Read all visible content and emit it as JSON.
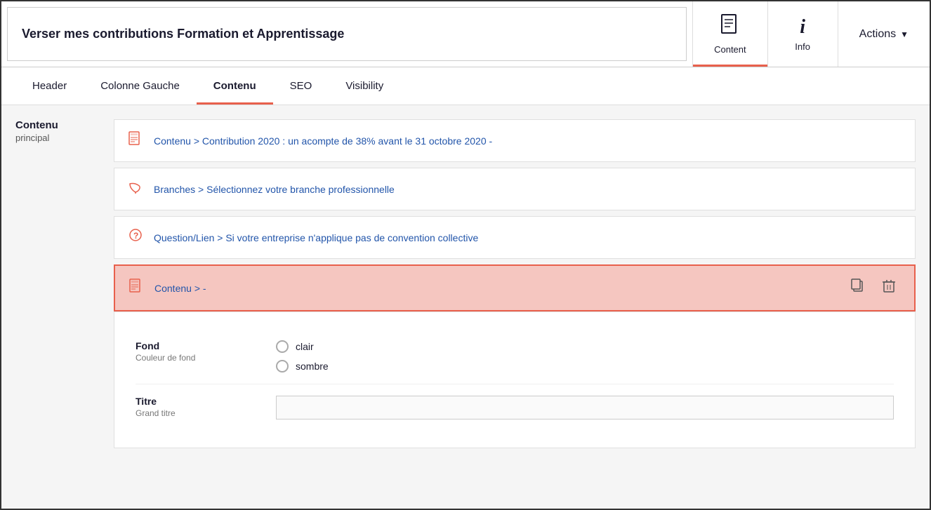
{
  "window": {
    "title": "Verser mes contributions Formation et Apprentissage"
  },
  "header": {
    "content_tab": {
      "label": "Content",
      "icon": "📄",
      "active": true
    },
    "info_tab": {
      "label": "Info",
      "icon": "i",
      "active": false
    },
    "actions_tab": {
      "label": "Actions"
    }
  },
  "tabs": [
    {
      "id": "header",
      "label": "Header",
      "active": false
    },
    {
      "id": "colonne-gauche",
      "label": "Colonne Gauche",
      "active": false
    },
    {
      "id": "contenu",
      "label": "Contenu",
      "active": true
    },
    {
      "id": "seo",
      "label": "SEO",
      "active": false
    },
    {
      "id": "visibility",
      "label": "Visibility",
      "active": false
    }
  ],
  "sidebar": {
    "label_main": "Contenu",
    "label_sub": "principal"
  },
  "list_items": [
    {
      "id": "item1",
      "icon_type": "document",
      "text": "Contenu > Contribution 2020 : un acompte de 38% avant le 31 octobre 2020 -",
      "selected": false
    },
    {
      "id": "item2",
      "icon_type": "leaf",
      "text": "Branches > Sélectionnez votre branche professionnelle",
      "selected": false
    },
    {
      "id": "item3",
      "icon_type": "question",
      "text": "Question/Lien > Si votre entreprise n'applique pas de convention collective",
      "selected": false
    },
    {
      "id": "item4",
      "icon_type": "document",
      "text": "Contenu > -",
      "selected": true
    }
  ],
  "detail": {
    "fond_label": "Fond",
    "fond_sub": "Couleur de fond",
    "radio_options": [
      {
        "id": "clair",
        "label": "clair"
      },
      {
        "id": "sombre",
        "label": "sombre"
      }
    ],
    "titre_label": "Titre",
    "titre_sub": "Grand titre",
    "titre_value": "",
    "titre_placeholder": ""
  },
  "icons": {
    "document": "▣",
    "leaf": "🍂",
    "question": "❓",
    "copy": "⧉",
    "trash": "🗑"
  }
}
